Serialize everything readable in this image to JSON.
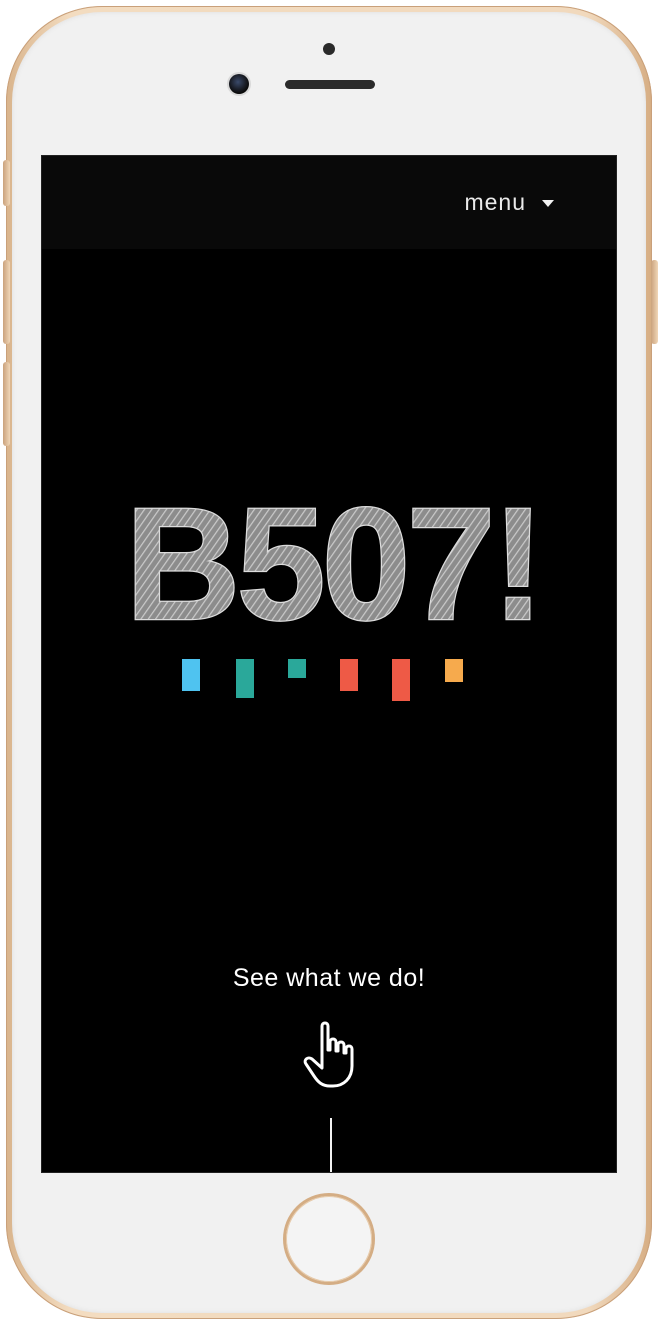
{
  "header": {
    "menu_label": "menu",
    "menu_icon": "caret-down-icon"
  },
  "hero": {
    "logo_text": "B507!",
    "logo_bar_colors": [
      "#4fc3f0",
      "#2aa89a",
      "#2aa89a",
      "#ee5a46",
      "#ee5a46",
      "#f6aa4d"
    ]
  },
  "cta": {
    "text": "See what we do!",
    "icon": "hand-pointer-icon"
  },
  "device": {
    "home_button": "home-button"
  }
}
